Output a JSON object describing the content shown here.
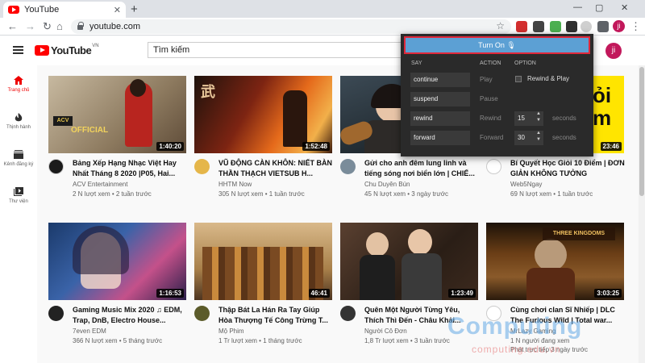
{
  "browser": {
    "tab_title": "YouTube",
    "tab_close": "✕",
    "new_tab": "+",
    "url": "youtube.com",
    "window_controls": [
      "—",
      "▢",
      "✕"
    ],
    "profile_initial": "ji"
  },
  "header": {
    "logo_text": "YouTube",
    "logo_region": "VN",
    "search_placeholder": "Tìm kiếm",
    "avatar_initial": "ji"
  },
  "sidebar": {
    "items": [
      {
        "label": "Trang chủ",
        "icon": "home-icon"
      },
      {
        "label": "Thịnh hành",
        "icon": "trending-icon"
      },
      {
        "label": "Kênh đăng ký",
        "icon": "subscriptions-icon"
      },
      {
        "label": "Thư viện",
        "icon": "library-icon"
      }
    ]
  },
  "popup": {
    "turn_on_label": "Turn On",
    "headers": {
      "say": "SAY",
      "action": "ACTION",
      "option": "OPTION"
    },
    "rows": [
      {
        "say": "continue",
        "action": "Play"
      },
      {
        "say": "suspend",
        "action": "Pause"
      },
      {
        "say": "rewind",
        "action": "Rewind",
        "value": "15",
        "unit": "seconds"
      },
      {
        "say": "forward",
        "action": "Forward",
        "value": "30",
        "unit": "seconds"
      }
    ],
    "option_label": "Rewind & Play"
  },
  "videos": [
    {
      "title": "Bảng Xếp Hạng Nhạc Việt Hay Nhất Tháng 8 2020 |P05, Hai...",
      "channel": "ACV Entertainment",
      "stats": "2 N lượt xem • 2 tuần trước",
      "duration": "1:40:20"
    },
    {
      "title": "VŨ ĐỘNG CÀN KHÔN: NIẾT BÀN THẦN THẠCH VIETSUB H...",
      "channel": "HHTM Now",
      "stats": "305 N lượt xem • 1 tuần trước",
      "duration": "1:52:48"
    },
    {
      "title": "Gửi cho anh đêm lung linh và tiếng sóng nơi biển lớn | CHIẾ...",
      "channel": "Chu Duyên Bún",
      "stats": "45 N lượt xem • 3 ngày trước",
      "duration": ""
    },
    {
      "title": "Bí Quyết Học Giỏi 10 Điểm | ĐƠN GIẢN KHÔNG TƯỞNG",
      "channel": "Web5Ngay",
      "stats": "69 N lượt xem • 1 tuần trước",
      "duration": "23:46"
    },
    {
      "title": "Gaming Music Mix 2020 ♫ EDM, Trap, DnB, Electro House...",
      "channel": "7even EDM",
      "stats": "366 N lượt xem • 5 tháng trước",
      "duration": "1:16:53"
    },
    {
      "title": "Thập Bát La Hán Ra Tay Giúp Hòa Thượng Tế Công Trừng T...",
      "channel": "Mộ Phim",
      "stats": "1 Tr lượt xem • 1 tháng trước",
      "duration": "46:41"
    },
    {
      "title": "Quên Một Người Từng Yêu, Thích Thì Đến - Châu Khải...",
      "channel": "Người Cô Đơn",
      "stats": "1,8 Tr lượt xem • 3 tuần trước",
      "duration": "1:23:49"
    },
    {
      "title": "Cùng chơi clan Sĩ Nhiếp | DLC The Furious Wild | Total war...",
      "channel": "MrLazy Gaming",
      "stats": "1 N người đang xem",
      "stats2": "Phát trực tiếp 3 ngày trước",
      "duration": "3:03:25"
    }
  ],
  "watermark": {
    "text": "Computing",
    "sub": "computing.edu.vn"
  }
}
